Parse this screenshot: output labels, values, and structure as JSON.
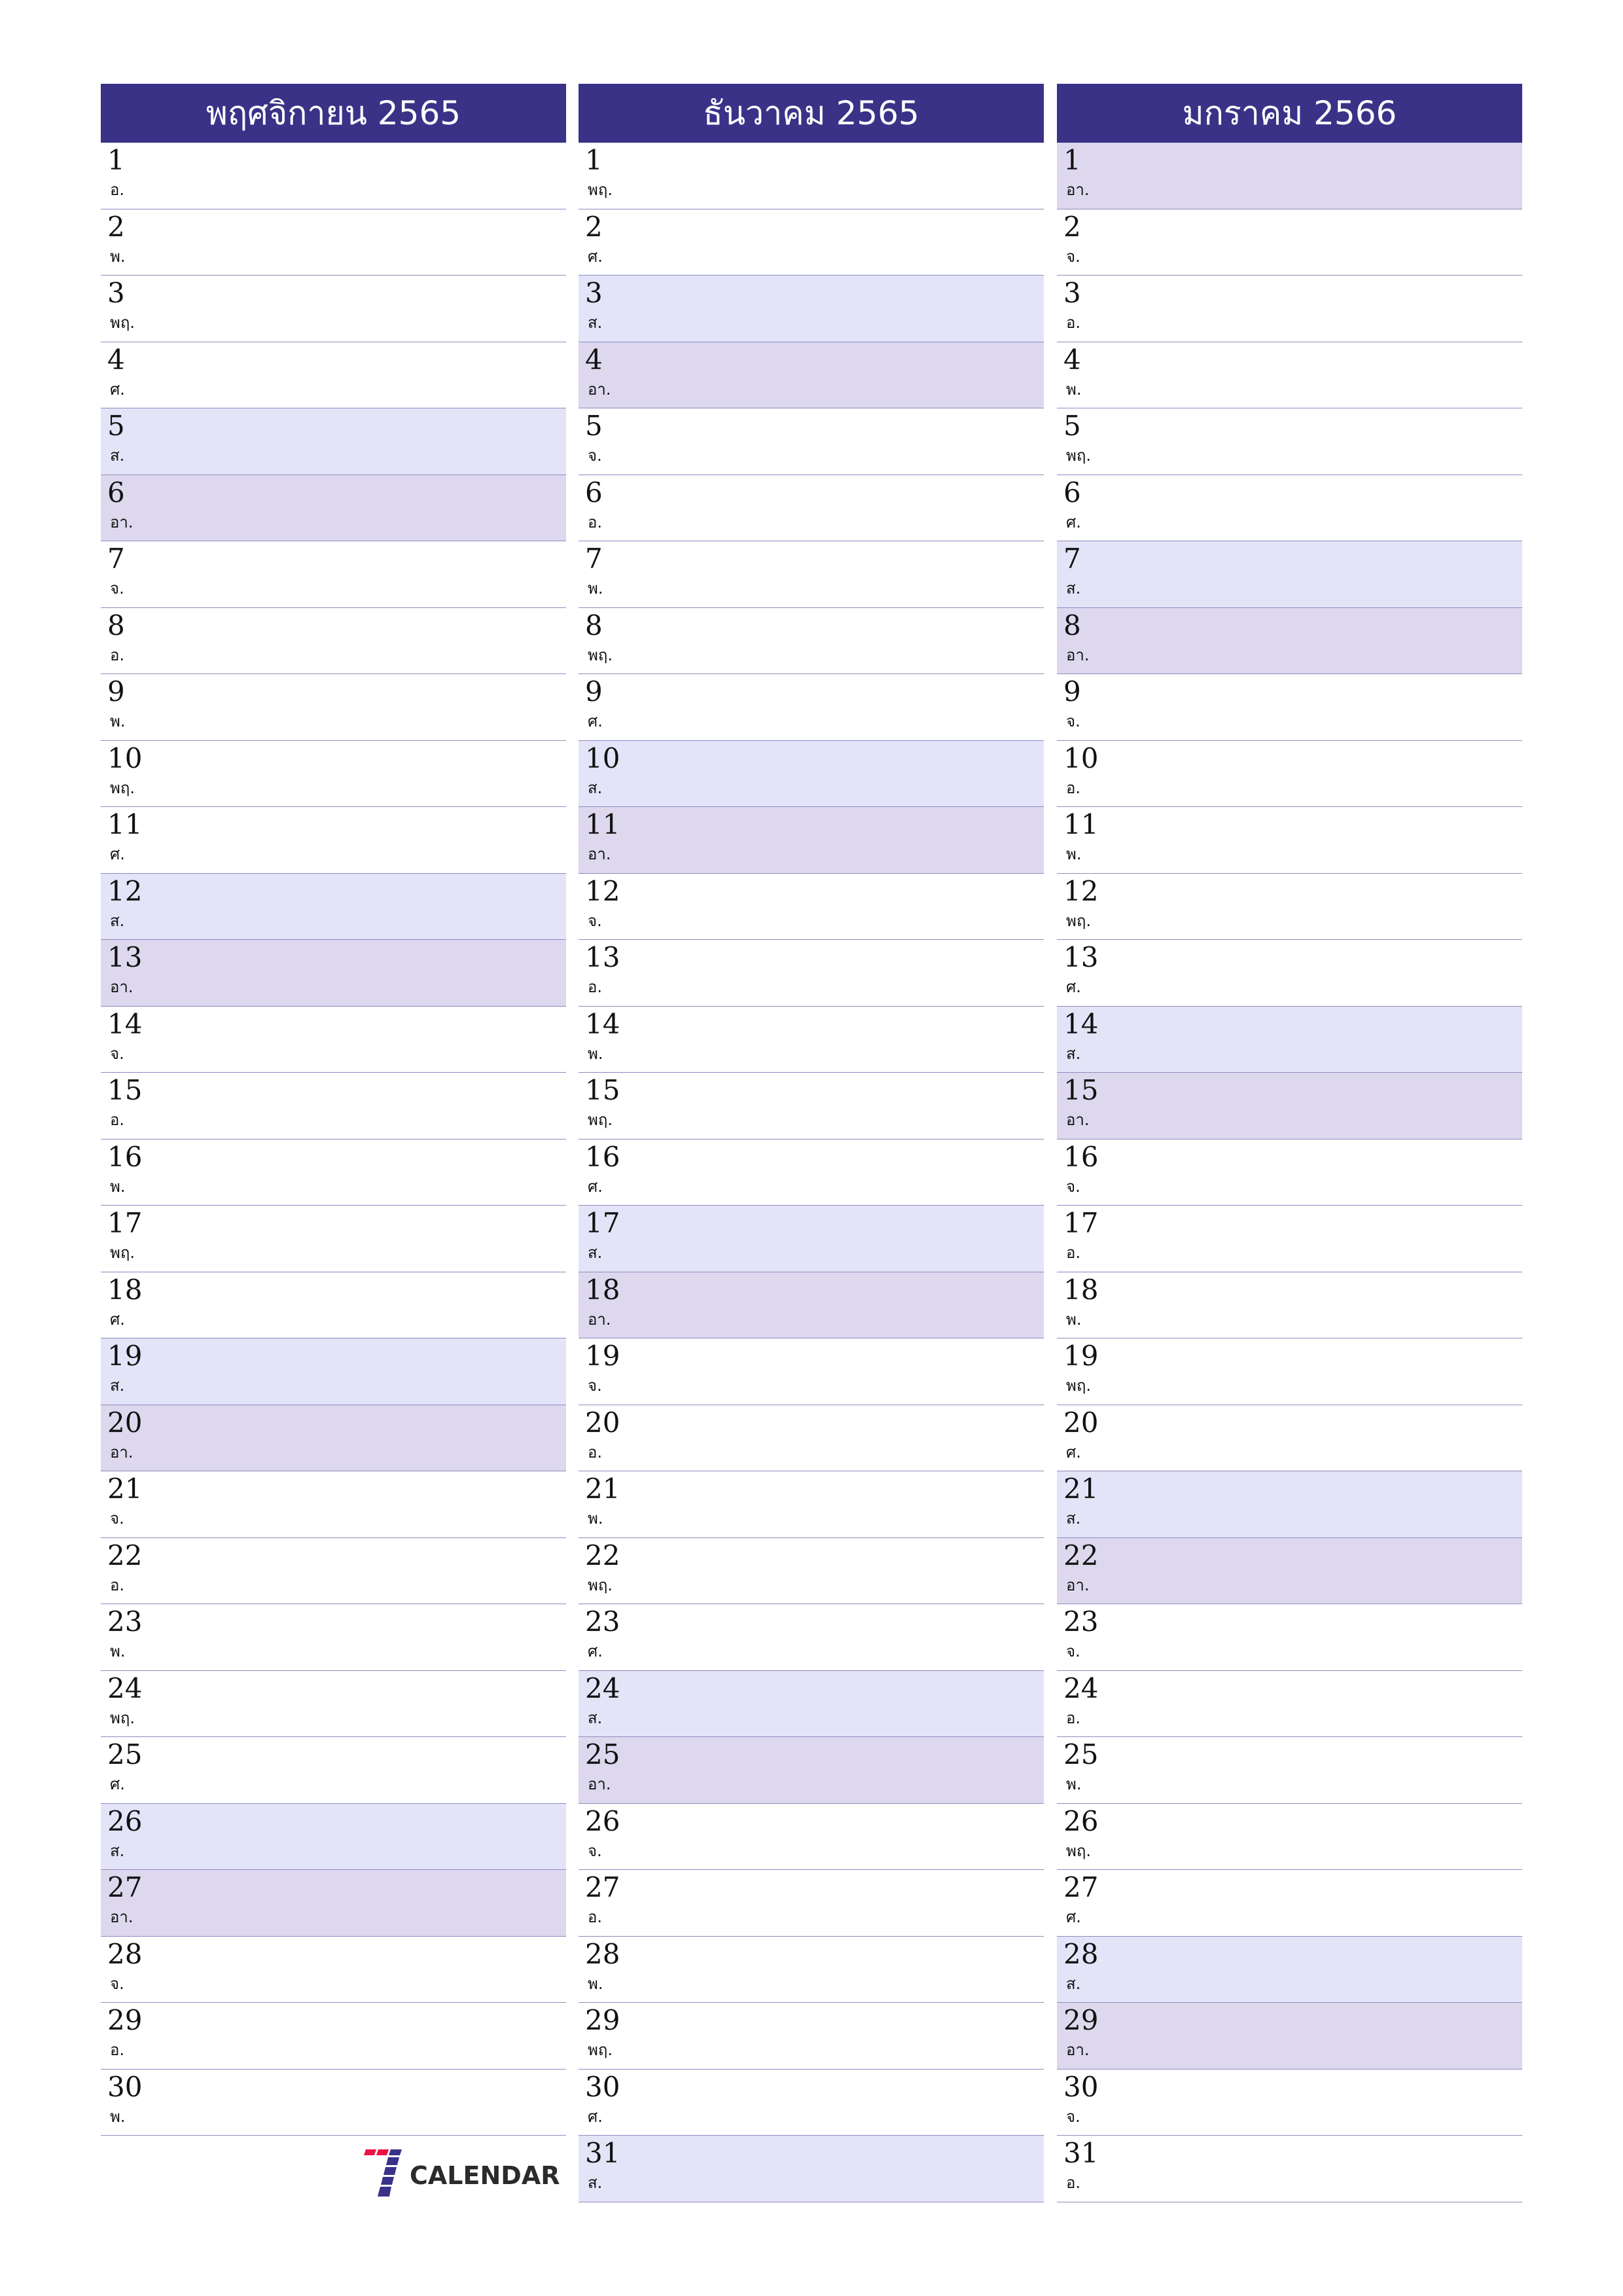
{
  "colors": {
    "header_bg": "#3A3287",
    "saturday_bg": "#E3E4F8",
    "sunday_bg": "#DDD8EE",
    "divider": "#8E8BC0",
    "logo_red": "#EE1144",
    "logo_blue": "#3A3189"
  },
  "months": [
    {
      "title": "พฤศจิกายน 2565",
      "days": [
        {
          "day": "1",
          "weekday": "อ."
        },
        {
          "day": "2",
          "weekday": "พ."
        },
        {
          "day": "3",
          "weekday": "พฤ."
        },
        {
          "day": "4",
          "weekday": "ศ."
        },
        {
          "day": "5",
          "weekday": "ส."
        },
        {
          "day": "6",
          "weekday": "อา."
        },
        {
          "day": "7",
          "weekday": "จ."
        },
        {
          "day": "8",
          "weekday": "อ."
        },
        {
          "day": "9",
          "weekday": "พ."
        },
        {
          "day": "10",
          "weekday": "พฤ."
        },
        {
          "day": "11",
          "weekday": "ศ."
        },
        {
          "day": "12",
          "weekday": "ส."
        },
        {
          "day": "13",
          "weekday": "อา."
        },
        {
          "day": "14",
          "weekday": "จ."
        },
        {
          "day": "15",
          "weekday": "อ."
        },
        {
          "day": "16",
          "weekday": "พ."
        },
        {
          "day": "17",
          "weekday": "พฤ."
        },
        {
          "day": "18",
          "weekday": "ศ."
        },
        {
          "day": "19",
          "weekday": "ส."
        },
        {
          "day": "20",
          "weekday": "อา."
        },
        {
          "day": "21",
          "weekday": "จ."
        },
        {
          "day": "22",
          "weekday": "อ."
        },
        {
          "day": "23",
          "weekday": "พ."
        },
        {
          "day": "24",
          "weekday": "พฤ."
        },
        {
          "day": "25",
          "weekday": "ศ."
        },
        {
          "day": "26",
          "weekday": "ส."
        },
        {
          "day": "27",
          "weekday": "อา."
        },
        {
          "day": "28",
          "weekday": "จ."
        },
        {
          "day": "29",
          "weekday": "อ."
        },
        {
          "day": "30",
          "weekday": "พ."
        }
      ]
    },
    {
      "title": "ธันวาคม 2565",
      "days": [
        {
          "day": "1",
          "weekday": "พฤ."
        },
        {
          "day": "2",
          "weekday": "ศ."
        },
        {
          "day": "3",
          "weekday": "ส."
        },
        {
          "day": "4",
          "weekday": "อา."
        },
        {
          "day": "5",
          "weekday": "จ."
        },
        {
          "day": "6",
          "weekday": "อ."
        },
        {
          "day": "7",
          "weekday": "พ."
        },
        {
          "day": "8",
          "weekday": "พฤ."
        },
        {
          "day": "9",
          "weekday": "ศ."
        },
        {
          "day": "10",
          "weekday": "ส."
        },
        {
          "day": "11",
          "weekday": "อา."
        },
        {
          "day": "12",
          "weekday": "จ."
        },
        {
          "day": "13",
          "weekday": "อ."
        },
        {
          "day": "14",
          "weekday": "พ."
        },
        {
          "day": "15",
          "weekday": "พฤ."
        },
        {
          "day": "16",
          "weekday": "ศ."
        },
        {
          "day": "17",
          "weekday": "ส."
        },
        {
          "day": "18",
          "weekday": "อา."
        },
        {
          "day": "19",
          "weekday": "จ."
        },
        {
          "day": "20",
          "weekday": "อ."
        },
        {
          "day": "21",
          "weekday": "พ."
        },
        {
          "day": "22",
          "weekday": "พฤ."
        },
        {
          "day": "23",
          "weekday": "ศ."
        },
        {
          "day": "24",
          "weekday": "ส."
        },
        {
          "day": "25",
          "weekday": "อา."
        },
        {
          "day": "26",
          "weekday": "จ."
        },
        {
          "day": "27",
          "weekday": "อ."
        },
        {
          "day": "28",
          "weekday": "พ."
        },
        {
          "day": "29",
          "weekday": "พฤ."
        },
        {
          "day": "30",
          "weekday": "ศ."
        },
        {
          "day": "31",
          "weekday": "ส."
        }
      ]
    },
    {
      "title": "มกราคม 2566",
      "days": [
        {
          "day": "1",
          "weekday": "อา."
        },
        {
          "day": "2",
          "weekday": "จ."
        },
        {
          "day": "3",
          "weekday": "อ."
        },
        {
          "day": "4",
          "weekday": "พ."
        },
        {
          "day": "5",
          "weekday": "พฤ."
        },
        {
          "day": "6",
          "weekday": "ศ."
        },
        {
          "day": "7",
          "weekday": "ส."
        },
        {
          "day": "8",
          "weekday": "อา."
        },
        {
          "day": "9",
          "weekday": "จ."
        },
        {
          "day": "10",
          "weekday": "อ."
        },
        {
          "day": "11",
          "weekday": "พ."
        },
        {
          "day": "12",
          "weekday": "พฤ."
        },
        {
          "day": "13",
          "weekday": "ศ."
        },
        {
          "day": "14",
          "weekday": "ส."
        },
        {
          "day": "15",
          "weekday": "อา."
        },
        {
          "day": "16",
          "weekday": "จ."
        },
        {
          "day": "17",
          "weekday": "อ."
        },
        {
          "day": "18",
          "weekday": "พ."
        },
        {
          "day": "19",
          "weekday": "พฤ."
        },
        {
          "day": "20",
          "weekday": "ศ."
        },
        {
          "day": "21",
          "weekday": "ส."
        },
        {
          "day": "22",
          "weekday": "อา."
        },
        {
          "day": "23",
          "weekday": "จ."
        },
        {
          "day": "24",
          "weekday": "อ."
        },
        {
          "day": "25",
          "weekday": "พ."
        },
        {
          "day": "26",
          "weekday": "พฤ."
        },
        {
          "day": "27",
          "weekday": "ศ."
        },
        {
          "day": "28",
          "weekday": "ส."
        },
        {
          "day": "29",
          "weekday": "อา."
        },
        {
          "day": "30",
          "weekday": "จ."
        },
        {
          "day": "31",
          "weekday": "อ."
        }
      ]
    }
  ],
  "weekend_labels": {
    "saturday": "ส.",
    "sunday": "อา."
  },
  "logo": {
    "icon": "seven-calendar-logo-icon",
    "text": "CALENDAR"
  }
}
